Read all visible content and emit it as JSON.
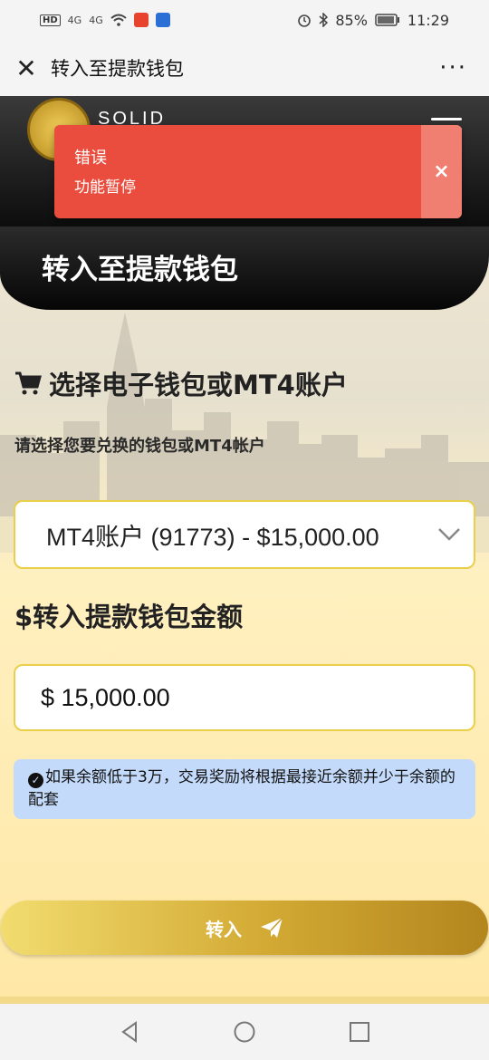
{
  "status_bar": {
    "hd": "HD",
    "signal_1": "4G",
    "signal_2": "4G",
    "battery_percent": "85%",
    "time": "11:29"
  },
  "title_bar": {
    "close_icon": "close-icon",
    "title": "转入至提款钱包",
    "more_icon": "more-dots-icon"
  },
  "header": {
    "logo_text": "SOLID",
    "menu_icon": "hamburger-icon"
  },
  "toast": {
    "title": "错误",
    "message": "功能暂停",
    "close_glyph": "×",
    "color": "#ea4d3d"
  },
  "page": {
    "title": "转入至提款钱包",
    "select_heading": "选择电子钱包或MT4账户",
    "select_hint": "请选择您要兑换的钱包或MT4帐户",
    "selected_account": "MT4账户 (91773) - $15,000.00",
    "amount_heading": "$转入提款钱包金额",
    "amount_value": "$ 15,000.00",
    "info_text": "如果余额低于3万，交易奖励将根据最接近余额并少于余额的配套",
    "submit_label": "转入"
  },
  "colors": {
    "accent_gold": "#d2a933",
    "info_bg": "#c4dafb",
    "border_gold": "#e9cf4a"
  }
}
